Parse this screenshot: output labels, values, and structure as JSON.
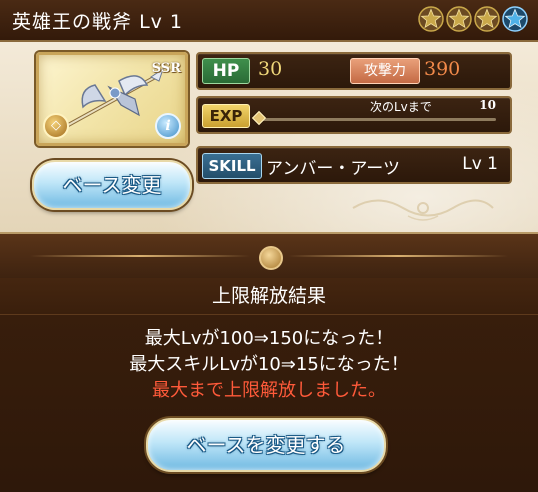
{
  "header": {
    "title": "英雄王の戦斧",
    "level_label": "Lv 1",
    "stars": [
      {
        "icon": "star-icon",
        "state": "uncap-gold"
      },
      {
        "icon": "star-icon",
        "state": "uncap-gold"
      },
      {
        "icon": "star-icon",
        "state": "uncap-gold"
      },
      {
        "icon": "star-icon",
        "state": "uncap-blue"
      }
    ]
  },
  "weapon": {
    "rarity": "SSR",
    "element_icon": "light-element-icon",
    "info_icon": "info-icon",
    "info_glyph": "i",
    "element_glyph": "◇"
  },
  "actions": {
    "base_change_label": "ベース変更",
    "change_base_label": "ベースを変更する"
  },
  "stats": {
    "hp_label": "HP",
    "hp_value": "30",
    "atk_label": "攻撃力",
    "atk_value": "390",
    "exp_label": "EXP",
    "next_lv_label": "次のLvまで",
    "next_lv_value": "10",
    "exp_progress": 0.0,
    "skill_label": "SKILL",
    "skill_name": "アンバー・アーツ",
    "skill_level": "Lv 1"
  },
  "result": {
    "title": "上限解放結果",
    "line1": "最大Lvが100⇒150になった！",
    "line2": "最大スキルLvが10⇒15になった！",
    "line3": "最大まで上限解放しました。"
  },
  "colors": {
    "star_gold": "#c9a84a",
    "star_blue": "#4fb2e8",
    "warning_red": "#ff5a3a",
    "hp_green": "#3f8f4c",
    "atk_orange": "#f28a4a"
  }
}
